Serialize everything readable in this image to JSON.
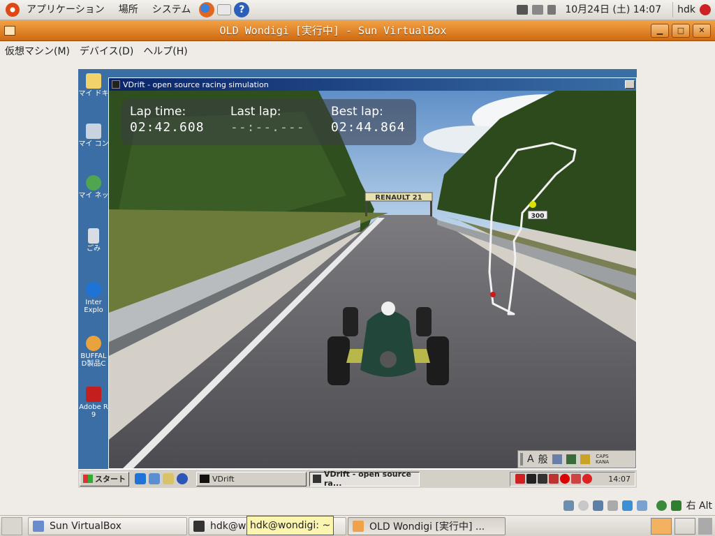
{
  "top_panel": {
    "menus": [
      "アプリケーション",
      "場所",
      "システム"
    ],
    "launchers": [
      "firefox-icon",
      "mail-icon",
      "help-icon"
    ],
    "datetime": "10月24日 (土) 14:07",
    "user": "hdk"
  },
  "vbox": {
    "title": "OLD Wondigi [実行中] - Sun VirtualBox",
    "menus": [
      "仮想マシン(M)",
      "デバイス(D)",
      "ヘルプ(H)"
    ],
    "status_text": "右 Alt"
  },
  "guest": {
    "desktop_icons": [
      {
        "label": "マイ ドキ",
        "icon": "folder-icon",
        "color": "#f2d36b"
      },
      {
        "label": "マイ コン",
        "icon": "computer-icon",
        "color": "#c9d3df"
      },
      {
        "label": "マイ ネッ",
        "icon": "network-icon",
        "color": "#4fa64f"
      },
      {
        "label": "ごみ",
        "icon": "trash-icon",
        "color": "#d8dde3"
      },
      {
        "label": "Inter Explo",
        "icon": "ie-icon",
        "color": "#1e73d6"
      },
      {
        "label": "BUFFAL D製品C",
        "icon": "buffalo-icon",
        "color": "#e8a33c"
      },
      {
        "label": "Adobe R 9",
        "icon": "adobe-icon",
        "color": "#c41e1e"
      }
    ],
    "vdrift": {
      "title": "VDrift - open source racing simulation",
      "hud": {
        "lap_time_label": "Lap time:",
        "lap_time": "02:42.608",
        "last_lap_label": "Last lap:",
        "last_lap": "--:--.---",
        "best_lap_label": "Best lap:",
        "best_lap": "02:44.864"
      },
      "banner": "RENAULT 21",
      "distance_sign": "300",
      "ime": {
        "a": "A",
        "mode": "般",
        "caps": "CAPS KANA"
      }
    },
    "taskbar": {
      "start": "スタート",
      "tasks": [
        "VDrift",
        "VDrift - open source ra..."
      ],
      "clock": "14:07"
    }
  },
  "bottom_panel": {
    "tasks": [
      "Sun VirtualBox",
      "hdk@w",
      "OLD Wondigi [実行中] ..."
    ],
    "tooltip": "hdk@wondigi: ~"
  },
  "colors": {
    "vbox_title_orange": "#d9761e",
    "guest_desktop_blue": "#3a6ea5",
    "hud_bg": "#4a4a55",
    "tooltip_yellow": "#fbf5b0"
  }
}
